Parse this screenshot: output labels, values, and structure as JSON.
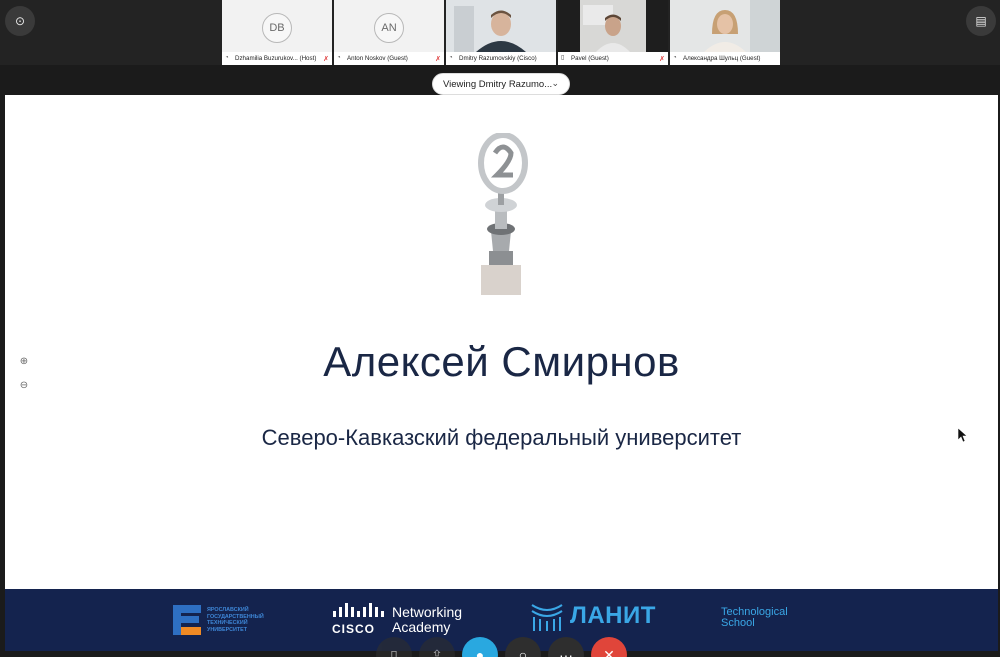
{
  "participants": [
    {
      "initials": "DB",
      "name": "Dzhamilia Buzurukov... (Host)",
      "muted": true,
      "has_video": false
    },
    {
      "initials": "AN",
      "name": "Anton Noskov (Guest)",
      "muted": true,
      "has_video": false
    },
    {
      "initials": "",
      "name": "Dmitry Razumovskiy (Cisco)",
      "muted": false,
      "has_video": true,
      "active": true
    },
    {
      "initials": "",
      "name": "Pavel (Guest)",
      "muted": true,
      "has_video": true
    },
    {
      "initials": "",
      "name": "Александра Шульц (Guest)",
      "muted": false,
      "has_video": true
    }
  ],
  "viewing_selector": {
    "label": "Viewing Dmitry Razumo..."
  },
  "slide": {
    "title": "Алексей Смирнов",
    "subtitle": "Северо-Кавказский федеральный университет"
  },
  "footer_logos": {
    "ystu_lines": [
      "ЯРОСЛАВСКИЙ",
      "ГОСУДАРСТВЕННЫЙ",
      "ТЕХНИЧЕСКИЙ",
      "УНИВЕРСИТЕТ"
    ],
    "cisco_word": "CISCO",
    "cisco_academy_line1": "Networking",
    "cisco_academy_line2": "Academy",
    "lanit": "ЛАНИТ",
    "tech_line1": "Technological",
    "tech_line2": "School"
  },
  "colors": {
    "slide_text": "#1a2745",
    "footer_bg": "#14234e",
    "accent_blue": "#29a8e0",
    "end_call_red": "#e0453a"
  }
}
